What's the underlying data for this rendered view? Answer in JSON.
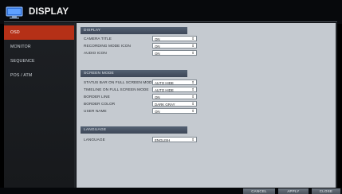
{
  "window": {
    "title": "DISPLAY"
  },
  "sidebar": {
    "items": [
      {
        "label": "OSD",
        "active": true
      },
      {
        "label": "MONITOR",
        "active": false
      },
      {
        "label": "SEQUENCE",
        "active": false
      },
      {
        "label": "POS / ATM",
        "active": false
      }
    ]
  },
  "sections": {
    "display": {
      "header": "DISPLAY",
      "rows": [
        {
          "label": "CAMERA TITLE",
          "value": "ON"
        },
        {
          "label": "RECORDING MODE ICON",
          "value": "ON"
        },
        {
          "label": "AUDIO ICON",
          "value": "ON"
        }
      ]
    },
    "screen_mode": {
      "header": "SCREEN MODE",
      "rows": [
        {
          "label": "STATUS BAR ON FULL SCREEN MODE",
          "value": "AUTO HIDE"
        },
        {
          "label": "TIMELINE ON FULL SCREEN MODE",
          "value": "AUTO HIDE"
        },
        {
          "label": "BORDER LINE",
          "value": "ON"
        },
        {
          "label": "BORDER COLOR",
          "value": "DARK GRAY"
        },
        {
          "label": "USER NAME",
          "value": "ON"
        }
      ]
    },
    "language": {
      "header": "LANGUAGE",
      "rows": [
        {
          "label": "LANGUAGE",
          "value": "ENGLISH"
        }
      ]
    }
  },
  "footer": {
    "cancel_label": "CANCEL",
    "apply_label": "APPLY",
    "close_label": "CLOSE"
  },
  "colors": {
    "accent": "#b53017",
    "section_header": "#4a5566",
    "content_bg": "#c5cad0",
    "sidebar_bg": "#1b1e22"
  },
  "icons": {
    "title_icon": "monitor-icon",
    "select_arrow": "spin-arrows-icon"
  }
}
